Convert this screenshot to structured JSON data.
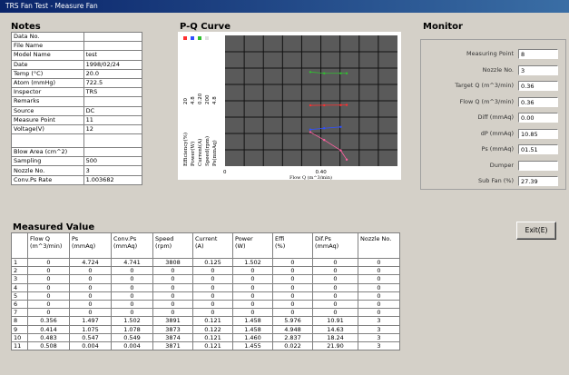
{
  "window": {
    "title": "TRS Fan Test - Measure Fan"
  },
  "notes": {
    "title": "Notes",
    "rows": [
      {
        "label": "Data No.",
        "value": ""
      },
      {
        "label": "File Name",
        "value": ""
      },
      {
        "label": "Model Name",
        "value": "test"
      },
      {
        "label": "Date",
        "value": "1998/02/24"
      },
      {
        "label": "Temp (°C)",
        "value": "20.0"
      },
      {
        "label": "Atom (mmHg)",
        "value": "722.5"
      },
      {
        "label": "Inspector",
        "value": "TRS"
      },
      {
        "label": "Remarks",
        "value": ""
      },
      {
        "label": "Source",
        "value": "DC"
      },
      {
        "label": "Measure Point",
        "value": "11"
      },
      {
        "label": "Voltage(V)",
        "value": "12"
      },
      {
        "label": "",
        "value": ""
      },
      {
        "label": "Blow Area (cm^2)",
        "value": ""
      },
      {
        "label": "Sampling",
        "value": "500"
      },
      {
        "label": "Nozzle No.",
        "value": "3"
      },
      {
        "label": "Conv.Ps Rate",
        "value": "1.003682"
      }
    ]
  },
  "chart_data": {
    "type": "scatter",
    "title": "P-Q Curve",
    "xlabel": "Flow Q (m^3/min)",
    "x_tick_labels": [
      "0",
      "0.40"
    ],
    "y_tick_labels": [
      "20",
      "4.8",
      "0.20",
      "200",
      "4.8"
    ],
    "y_axis_names": [
      "Efficiency(%)",
      "Power(W)",
      "Current(A)",
      "Speed(rpm)",
      "Ps(mmAq)"
    ],
    "legend_marker_colors": [
      "#ff3030",
      "#3050ff",
      "#30c030",
      "#e0e0e0"
    ],
    "series": [
      {
        "color": "#30c030",
        "x": [
          0.356,
          0.414,
          0.483,
          0.508
        ],
        "y": [
          0.72,
          0.71,
          0.71,
          0.71
        ]
      },
      {
        "color": "#ff3030",
        "x": [
          0.356,
          0.414,
          0.483,
          0.508
        ],
        "y": [
          0.465,
          0.466,
          0.467,
          0.468
        ]
      },
      {
        "color": "#3050ff",
        "x": [
          0.356,
          0.414,
          0.483
        ],
        "y": [
          0.28,
          0.29,
          0.3
        ]
      },
      {
        "color": "#ff60a0",
        "x": [
          0.356,
          0.414,
          0.483,
          0.508
        ],
        "y": [
          0.26,
          0.2,
          0.12,
          0.05
        ]
      }
    ]
  },
  "monitor": {
    "title": "Monitor",
    "rows": [
      {
        "label": "Measuring Point",
        "value": "8"
      },
      {
        "label": "Nozzle No.",
        "value": "3"
      },
      {
        "label": "Target Q (m^3/min)",
        "value": "0.36"
      },
      {
        "label": "Flow Q (m^3/min)",
        "value": "0.36"
      },
      {
        "label": "Diff (mmAq)",
        "value": "0.00"
      },
      {
        "label": "dP (mmAq)",
        "value": "10.85"
      },
      {
        "label": "Ps (mmAq)",
        "value": "01.51"
      },
      {
        "label": "Dumper",
        "value": ""
      },
      {
        "label": "Sub Fan (%)",
        "value": "27.39"
      }
    ]
  },
  "exit_button": {
    "label": "Exit(E)"
  },
  "measured": {
    "title": "Measured Value",
    "headers": [
      "",
      "Flow Q\n(m^3/min)",
      "Ps\n(mmAq)",
      "Conv.Ps\n(mmAq)",
      "Speed\n(rpm)",
      "Current\n(A)",
      "Power\n(W)",
      "Effi\n(%)",
      "Dif.Ps\n(mmAq)",
      "Nozzle No."
    ],
    "rows": [
      [
        "1",
        "0",
        "4.724",
        "4.741",
        "3808",
        "0.125",
        "1.502",
        "0",
        "0",
        "0"
      ],
      [
        "2",
        "0",
        "0",
        "0",
        "0",
        "0",
        "0",
        "0",
        "0",
        "0"
      ],
      [
        "3",
        "0",
        "0",
        "0",
        "0",
        "0",
        "0",
        "0",
        "0",
        "0"
      ],
      [
        "4",
        "0",
        "0",
        "0",
        "0",
        "0",
        "0",
        "0",
        "0",
        "0"
      ],
      [
        "5",
        "0",
        "0",
        "0",
        "0",
        "0",
        "0",
        "0",
        "0",
        "0"
      ],
      [
        "6",
        "0",
        "0",
        "0",
        "0",
        "0",
        "0",
        "0",
        "0",
        "0"
      ],
      [
        "7",
        "0",
        "0",
        "0",
        "0",
        "0",
        "0",
        "0",
        "0",
        "0"
      ],
      [
        "8",
        "0.356",
        "1.497",
        "1.502",
        "3891",
        "0.121",
        "1.458",
        "5.976",
        "10.91",
        "3"
      ],
      [
        "9",
        "0.414",
        "1.075",
        "1.078",
        "3873",
        "0.122",
        "1.458",
        "4.948",
        "14.63",
        "3"
      ],
      [
        "10",
        "0.483",
        "0.547",
        "0.549",
        "3874",
        "0.121",
        "1.460",
        "2.837",
        "18.24",
        "3"
      ],
      [
        "11",
        "0.508",
        "0.004",
        "0.004",
        "3871",
        "0.121",
        "1.455",
        "0.022",
        "21.90",
        "3"
      ]
    ]
  }
}
